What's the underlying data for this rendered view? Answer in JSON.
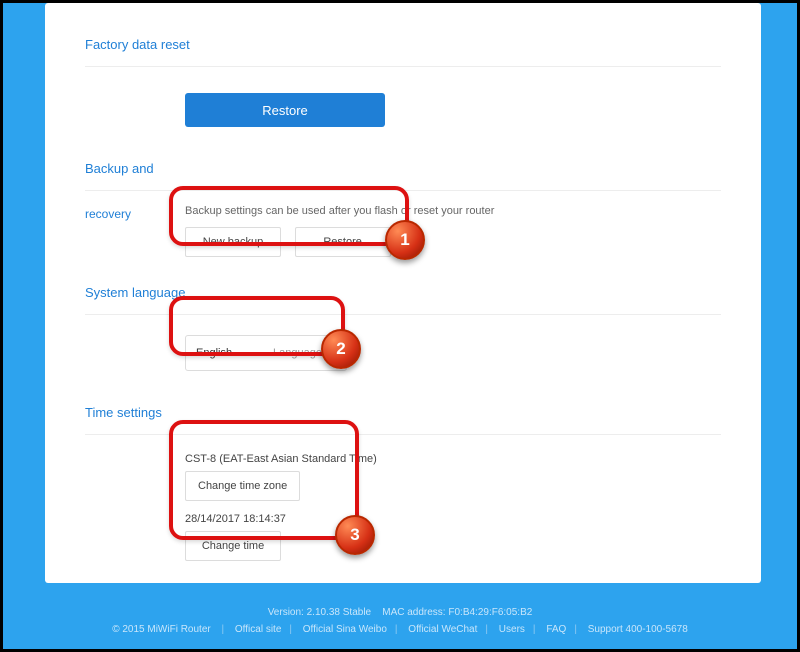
{
  "factory": {
    "title": "Factory data reset",
    "restore": "Restore"
  },
  "backup": {
    "title": "Backup and",
    "subtitle": "recovery",
    "hint": "Backup settings can be used after you flash or reset your router",
    "new_backup": "New backup",
    "restore": "Restore"
  },
  "lang": {
    "title": "System language",
    "value": "English",
    "label": "Language"
  },
  "time": {
    "title": "Time settings",
    "tz": "CST-8 (EAT-East Asian Standard Time)",
    "change_tz": "Change time zone",
    "now": "28/14/2017 18:14:37",
    "change_time": "Change time"
  },
  "footer": {
    "line1_version": "Version: 2.10.38 Stable",
    "line1_mac": "MAC address: F0:B4:29:F6:05:B2",
    "copyright": "© 2015 MiWiFi Router",
    "links": [
      "Offical site",
      "Official Sina Weibo",
      "Official WeChat",
      "Users",
      "FAQ",
      "Support 400-100-5678"
    ]
  },
  "ann": {
    "1": "1",
    "2": "2",
    "3": "3"
  }
}
